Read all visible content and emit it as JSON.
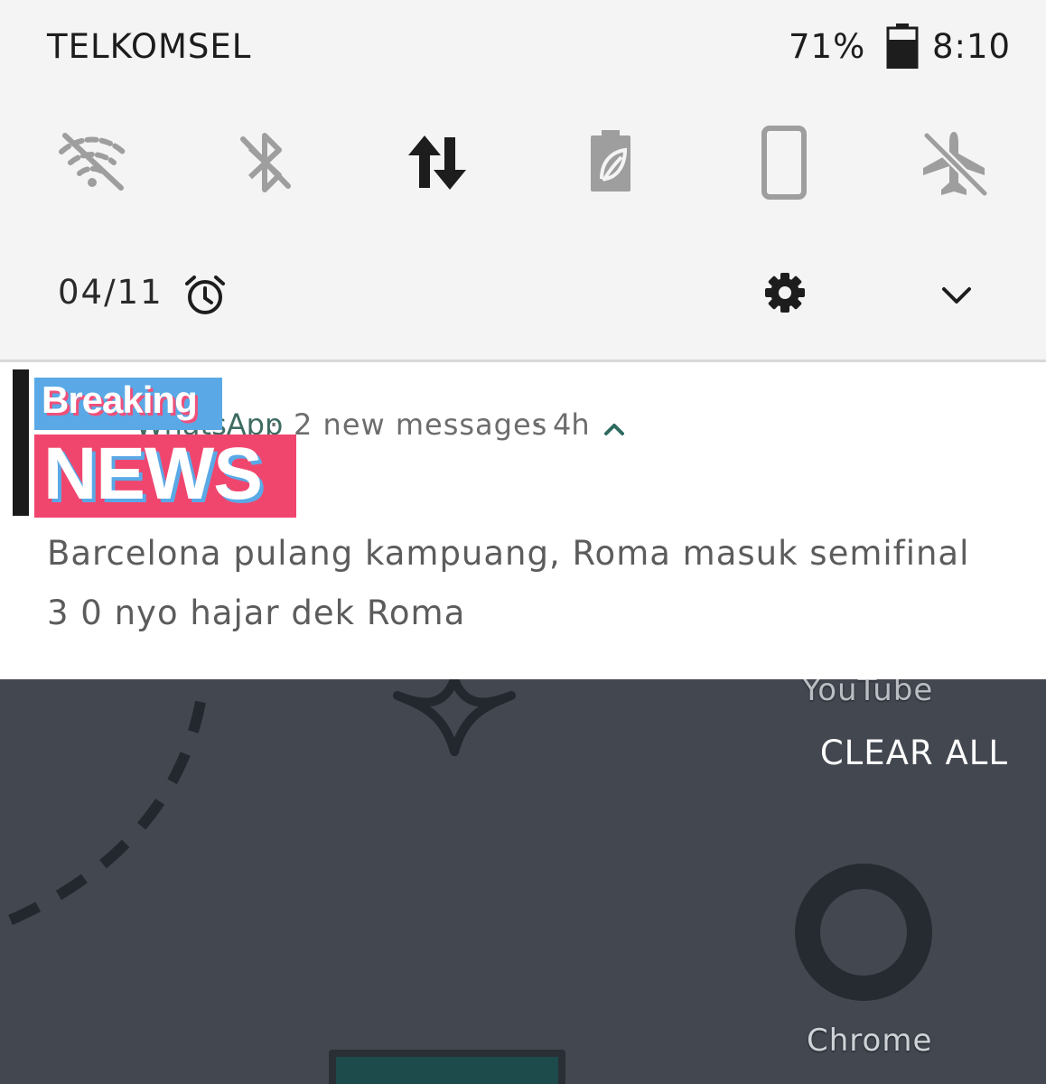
{
  "status_bar": {
    "carrier": "TELKOMSEL",
    "battery_percent": "71%",
    "battery_level": 0.71,
    "time": "8:10"
  },
  "quick_settings": {
    "tiles": [
      {
        "name": "wifi",
        "icon": "wifi-off-icon",
        "state": "off"
      },
      {
        "name": "bluetooth",
        "icon": "bluetooth-off-icon",
        "state": "off"
      },
      {
        "name": "mobile-data",
        "icon": "data-transfer-icon",
        "state": "on"
      },
      {
        "name": "battery-saver",
        "icon": "battery-saver-icon",
        "state": "off"
      },
      {
        "name": "auto-rotate",
        "icon": "phone-portrait-icon",
        "state": "off"
      },
      {
        "name": "airplane-mode",
        "icon": "airplane-off-icon",
        "state": "off"
      }
    ],
    "date": "04/11",
    "alarm_icon": "alarm-clock-icon",
    "settings_icon": "gear-icon",
    "expand_icon": "chevron-down-icon"
  },
  "notification": {
    "app_name": "WhatsApp",
    "separator": "·",
    "summary": "2 new messages",
    "time_ago": "4h",
    "messages": [
      "Barcelona pulang kampuang, Roma masuk semifinal",
      "3 0 nyo hajar dek Roma"
    ],
    "overlay": {
      "top_text": "Breaking",
      "bottom_text": "NEWS"
    }
  },
  "home_screen": {
    "clear_all_label": "CLEAR ALL",
    "apps": [
      "YouTube",
      "Chrome"
    ]
  },
  "colors": {
    "shade_bg": "#f4f4f4",
    "icon_inactive": "#9e9e9e",
    "icon_active": "#1d1d1d",
    "home_bg": "#424750",
    "accent_teal": "#3e6b62",
    "news_blue": "#5aa9e6",
    "news_pink": "#f0466e"
  }
}
